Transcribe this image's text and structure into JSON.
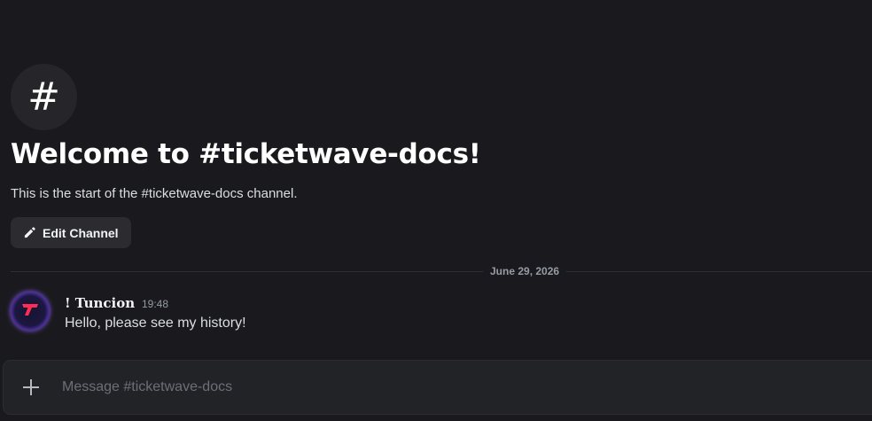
{
  "channel": {
    "hash_icon": "#",
    "welcome_title": "Welcome to #ticketwave-docs!",
    "welcome_subtitle": "This is the start of the #ticketwave-docs channel.",
    "edit_button_label": "Edit Channel"
  },
  "divider": {
    "date": "June 29, 2026"
  },
  "messages": [
    {
      "author": "! Tuncion",
      "timestamp": "19:48",
      "text": "Hello, please see my history!",
      "avatar_icon": "ticketwave-logo-icon"
    }
  ],
  "composer": {
    "placeholder": "Message #ticketwave-docs"
  },
  "colors": {
    "background": "#1a1a1e",
    "accent_avatar_glow": "#8a5cff",
    "logo_red": "#ff2d55"
  }
}
